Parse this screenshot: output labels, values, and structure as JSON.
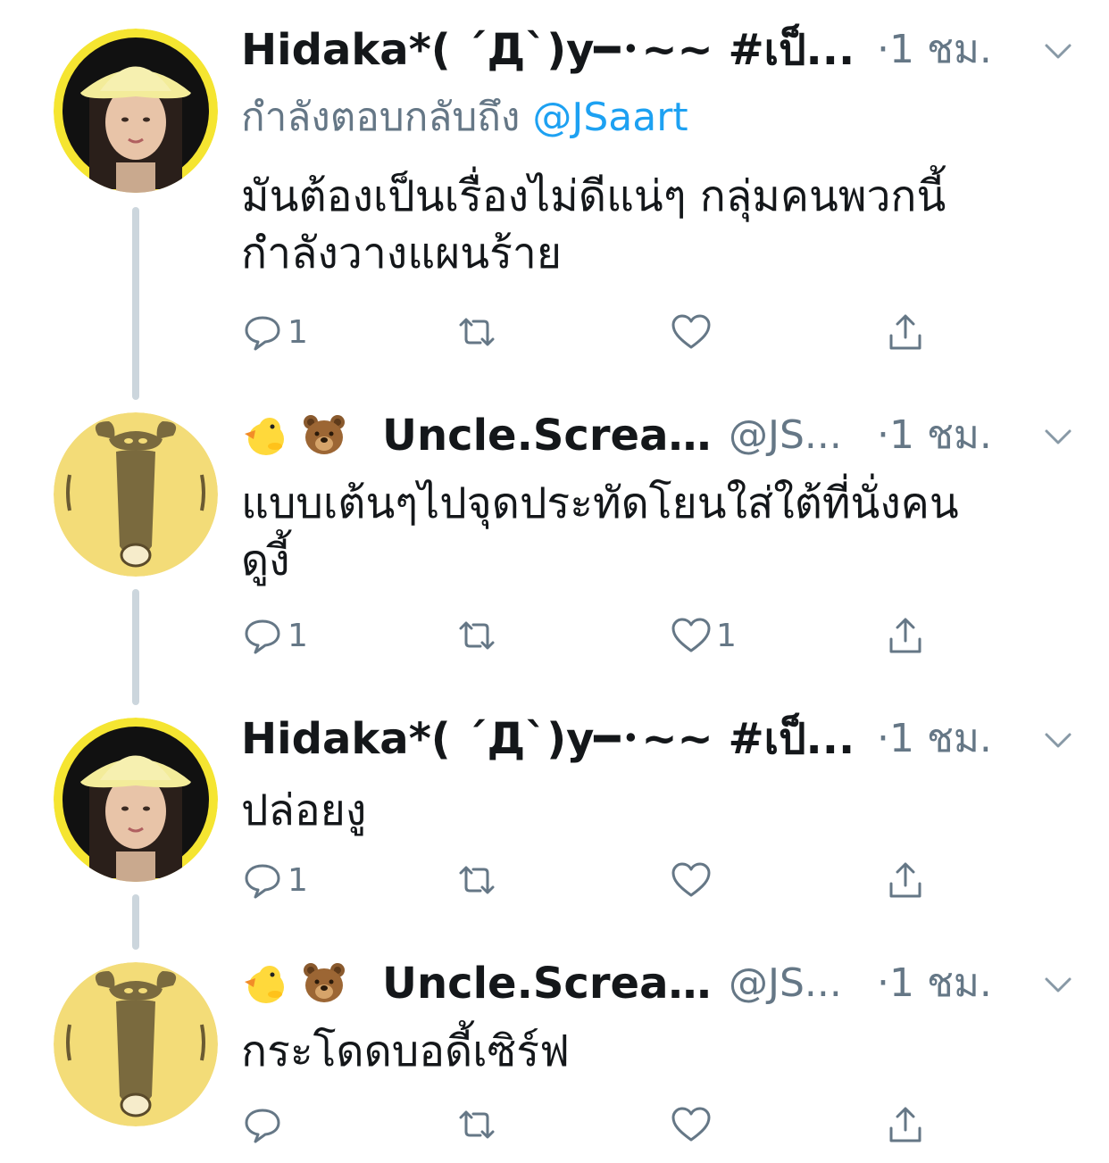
{
  "tweets": [
    {
      "name": "Hidaka*( ´Д`)y━･~~ #เป็...",
      "handle": "",
      "time": "·1 ชม.",
      "reply_prefix": "กำลังตอบกลับถึง",
      "reply_mention": "@JSaart",
      "text_lines": [
        "มันต้องเป็นเรื่องไม่ดีแน่ๆ กลุ่มคนพวกนี้",
        "กำลังวางแผนร้าย"
      ],
      "reply_count": "1",
      "retweet_count": "",
      "like_count": "",
      "avatar": "girl-yellow-hat-avatar"
    },
    {
      "name": "Uncle.Scream.",
      "name_emojis": [
        "chick-emoji",
        "bear-emoji"
      ],
      "handle": "@JS...",
      "time": "·1 ชม.",
      "text_lines": [
        "แบบเต้นๆไปจุดประทัดโยนใส่ใต้ที่นั่งคน",
        "ดูงี้"
      ],
      "reply_count": "1",
      "retweet_count": "",
      "like_count": "1",
      "avatar": "scream-cartoon-avatar"
    },
    {
      "name": "Hidaka*( ´Д`)y━･~~ #เป็...",
      "handle": "",
      "time": "·1 ชม.",
      "text_lines": [
        "ปล่อยงู"
      ],
      "reply_count": "1",
      "retweet_count": "",
      "like_count": "",
      "avatar": "girl-yellow-hat-avatar"
    },
    {
      "name": "Uncle.Scream.",
      "name_emojis": [
        "chick-emoji",
        "bear-emoji"
      ],
      "handle": "@JS...",
      "time": "·1 ชม.",
      "text_lines": [
        "กระโดดบอดี้เซิร์ฟ"
      ],
      "reply_count": "",
      "retweet_count": "",
      "like_count": "",
      "avatar": "scream-cartoon-avatar"
    }
  ],
  "colors": {
    "text": "#14171a",
    "secondary": "#657786",
    "link": "#1da1f2",
    "thread_line": "#ccd6dd",
    "avatar_ring": "#f5e531",
    "scream_bg": "#f3dc78"
  }
}
